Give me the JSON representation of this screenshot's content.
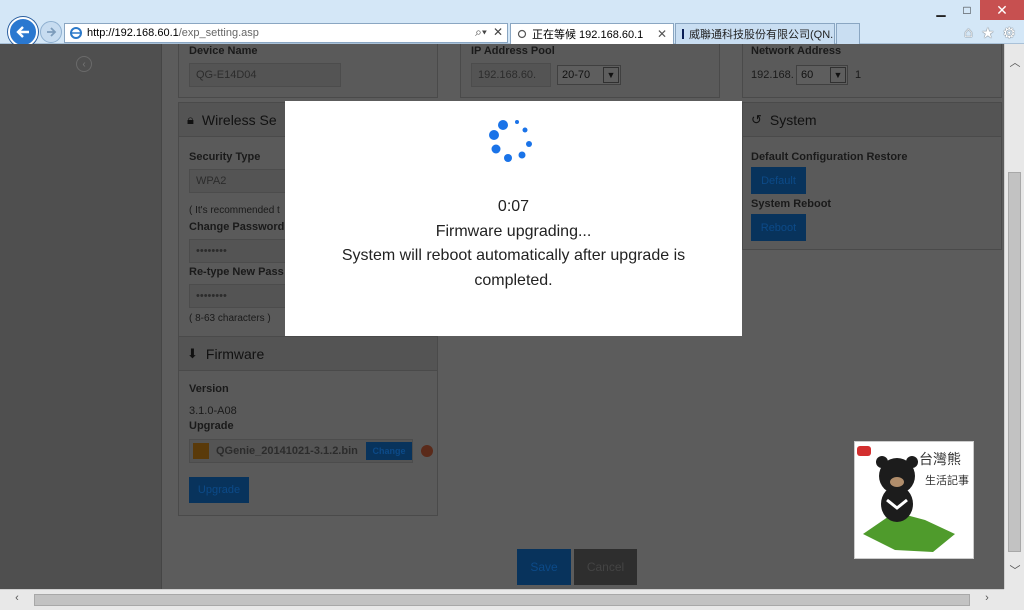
{
  "browser": {
    "address": {
      "host": "http://192.168.60.1",
      "path": "/exp_setting.asp"
    },
    "tabs": [
      {
        "label": "正在等候 192.168.60.1",
        "active": true
      },
      {
        "label": "威聯通科技股份有限公司(QN...",
        "active": false
      }
    ],
    "window_buttons": {
      "minimize": "▁",
      "maximize": "□",
      "close": "✕"
    }
  },
  "network": {
    "device_name_label": "Device Name",
    "device_name_value": "QG-E14D04",
    "ip_pool_label": "IP Address Pool",
    "ip_pool_prefix": "192.168.60.",
    "ip_pool_range": "20-70",
    "network_address_label": "Network Address",
    "network_address_prefix": "192.168.",
    "network_address_third": "60",
    "network_address_suffix": "1"
  },
  "wireless": {
    "title": "Wireless Se",
    "security_type_label": "Security Type",
    "security_type_value": "WPA2",
    "recommend_note": "( It's recommended t",
    "change_password_label": "Change Password",
    "password_value": "••••••••",
    "retype_label": "Re-type New Pass",
    "retype_value": "••••••••",
    "chars_note": "( 8-63 characters )"
  },
  "system": {
    "title": "System",
    "default_restore_label": "Default Configuration Restore",
    "default_button": "Default",
    "reboot_label": "System Reboot",
    "reboot_button": "Reboot"
  },
  "firmware": {
    "title": "Firmware",
    "version_label": "Version",
    "version_value": "3.1.0-A08",
    "upgrade_label": "Upgrade",
    "file_name": "QGenie_20141021-3.1.2.bin",
    "change_button": "Change",
    "upgrade_button": "Upgrade"
  },
  "footer": {
    "save_button": "Save",
    "cancel_button": "Cancel"
  },
  "modal": {
    "timer": "0:07",
    "line1": "Firmware upgrading...",
    "line2": "System will reboot automatically after upgrade is",
    "line3": "completed."
  },
  "colors": {
    "accent": "#1a73e8",
    "brand_dark": "#08335c",
    "close_red": "#c75050"
  }
}
